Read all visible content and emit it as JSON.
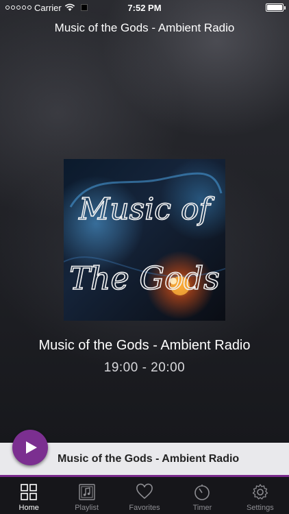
{
  "status_bar": {
    "carrier": "Carrier",
    "time": "7:52 PM"
  },
  "header": {
    "title": "Music of the Gods - Ambient Radio"
  },
  "artwork": {
    "icon": "album-artwork",
    "text_line1": "Music of",
    "text_line2": "The Gods"
  },
  "now_playing": {
    "title": "Music of the Gods - Ambient Radio",
    "time_range": "19:00 - 20:00"
  },
  "mini_player": {
    "title": "Music of the Gods - Ambient Radio",
    "play_icon": "play-icon",
    "accent_color": "#7b2f90"
  },
  "tabs": [
    {
      "label": "Home",
      "icon": "grid-icon",
      "active": true
    },
    {
      "label": "Playlist",
      "icon": "music-note-icon",
      "active": false
    },
    {
      "label": "Favorites",
      "icon": "heart-icon",
      "active": false
    },
    {
      "label": "Timer",
      "icon": "timer-icon",
      "active": false
    },
    {
      "label": "Settings",
      "icon": "gear-icon",
      "active": false
    }
  ]
}
